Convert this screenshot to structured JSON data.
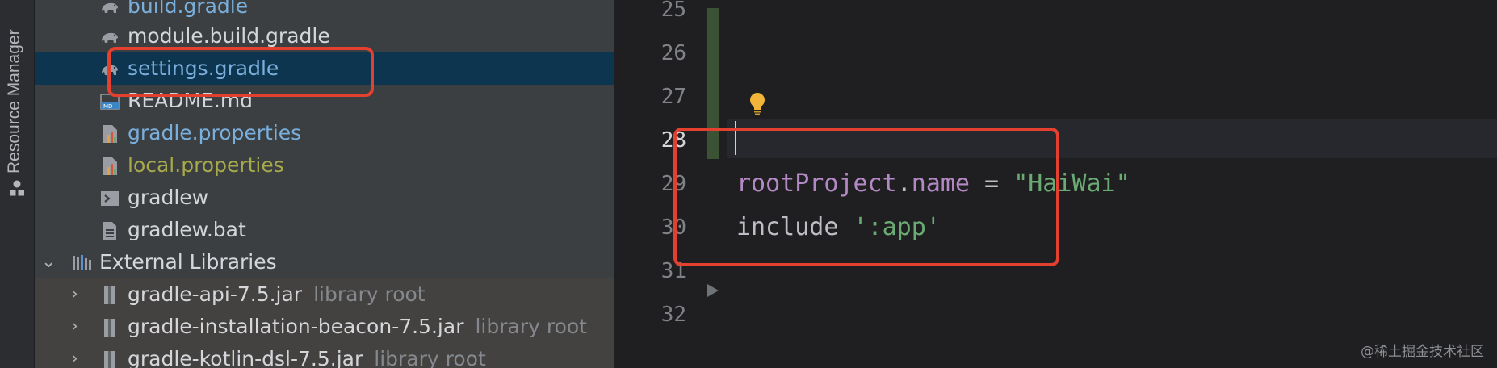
{
  "side_strip": {
    "label": "Resource Manager",
    "icon": "resource-manager-icon"
  },
  "project_tree": {
    "items": [
      {
        "name": "build.gradle",
        "icon": "gradle-elephant-icon",
        "color": "#7aaedb"
      },
      {
        "name": "module.build.gradle",
        "icon": "gradle-elephant-icon",
        "color": "#d4d6da"
      },
      {
        "name": "settings.gradle",
        "icon": "gradle-elephant-icon",
        "color": "#7aaedb",
        "selected": true
      },
      {
        "name": "README.md",
        "icon": "markdown-file-icon",
        "color": "#d4d6da"
      },
      {
        "name": "gradle.properties",
        "icon": "properties-file-icon",
        "color": "#7aaedb"
      },
      {
        "name": "local.properties",
        "icon": "properties-file-icon",
        "color": "#a8a94a"
      },
      {
        "name": "gradlew",
        "icon": "terminal-file-icon",
        "color": "#d4d6da"
      },
      {
        "name": "gradlew.bat",
        "icon": "text-file-icon",
        "color": "#d4d6da"
      }
    ],
    "external_libraries": {
      "label": "External Libraries",
      "icon": "libraries-icon",
      "expanded": true,
      "items": [
        {
          "name": "gradle-api-7.5.jar",
          "suffix": "library root",
          "icon": "jar-icon"
        },
        {
          "name": "gradle-installation-beacon-7.5.jar",
          "suffix": "library root",
          "icon": "jar-icon"
        },
        {
          "name": "gradle-kotlin-dsl-7.5.jar",
          "suffix": "library root",
          "icon": "jar-icon"
        }
      ]
    }
  },
  "editor": {
    "line_numbers": [
      "25",
      "26",
      "27",
      "28",
      "29",
      "30",
      "31",
      "32"
    ],
    "active_line": "28",
    "code": {
      "line29": {
        "ident": "rootProject",
        "dot": ".",
        "prop": "name",
        "eq": " = ",
        "str": "\"HaiWai\""
      },
      "line30": {
        "kw": "include",
        "str": "':app'"
      }
    },
    "colors": {
      "ident": "#b389c5",
      "string": "#6aab73",
      "plain": "#bcbec4"
    }
  },
  "watermark": "@稀土掘金技术社区",
  "highlight_color": "#e4402f"
}
